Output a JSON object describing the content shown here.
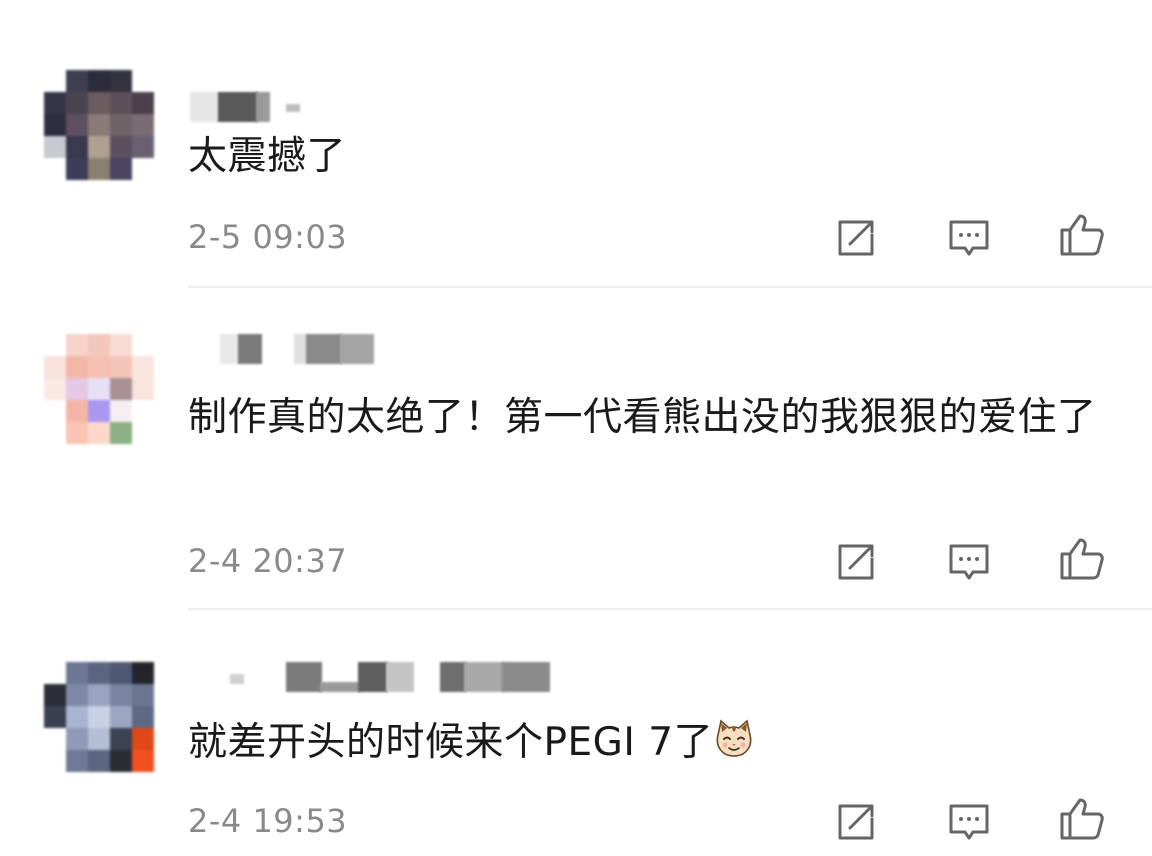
{
  "comments": [
    {
      "text": "太震撼了",
      "time": "2-5 09:03"
    },
    {
      "text": "制作真的太绝了！第一代看熊出没的我狠狠的爱住了",
      "time": "2-4 20:37"
    },
    {
      "text": "就差开头的时候来个PEGI 7了",
      "emoji": "cat-face-emoji",
      "time": "2-4 19:53"
    }
  ],
  "actions": {
    "forward_icon": "share-square-arrow-icon",
    "reply_icon": "comment-bubble-icon",
    "like_icon": "thumbs-up-icon"
  },
  "colors": {
    "text": "#1a1a1a",
    "timestamp": "#8a8a8a",
    "icon": "#666666",
    "divider": "#eeeeee"
  }
}
